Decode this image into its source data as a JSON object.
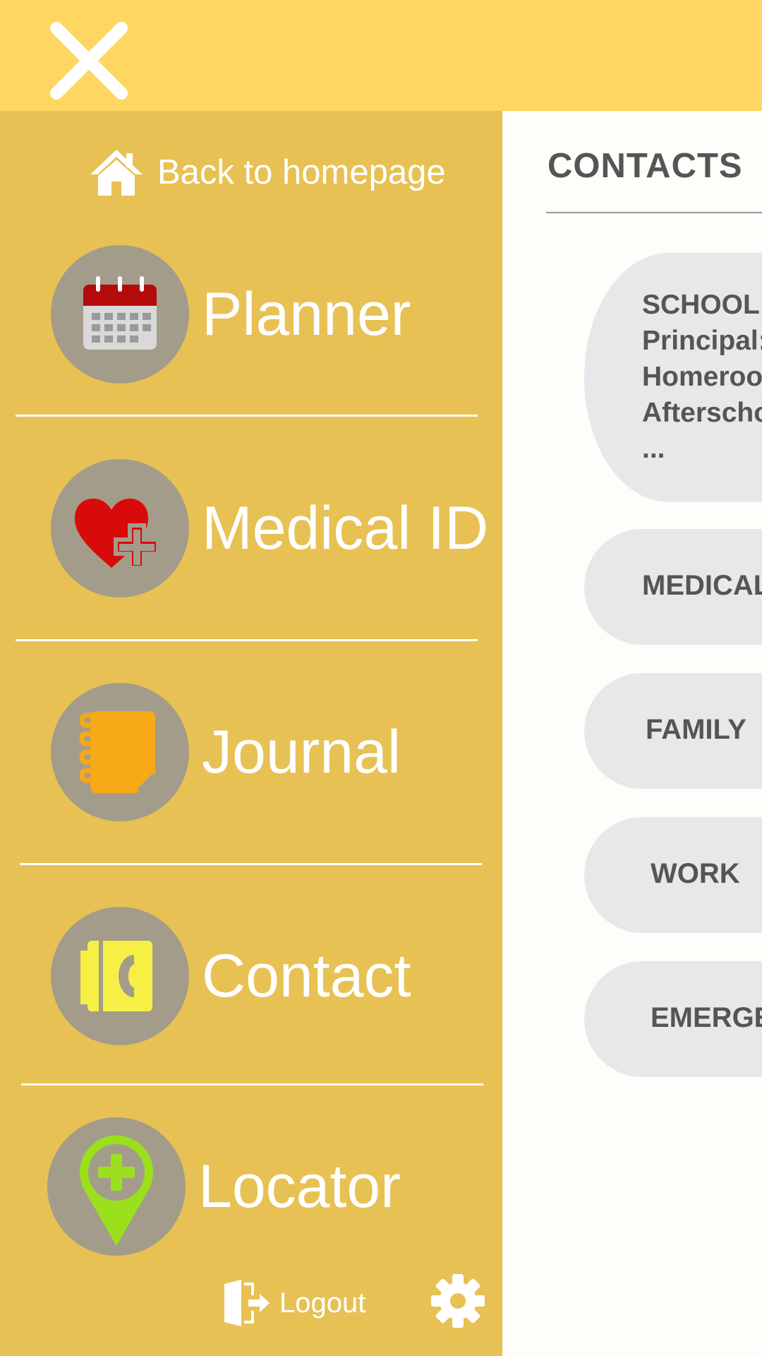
{
  "header": {
    "close_icon": "close-icon"
  },
  "sidebar": {
    "home_link": "Back to homepage",
    "items": [
      {
        "label": "Planner",
        "icon": "calendar-icon"
      },
      {
        "label": "Medical ID",
        "icon": "heart-plus-icon"
      },
      {
        "label": "Journal",
        "icon": "notebook-icon"
      },
      {
        "label": "Contact",
        "icon": "contact-book-icon"
      },
      {
        "label": "Locator",
        "icon": "map-pin-plus-icon"
      }
    ],
    "logout": "Logout",
    "settings_icon": "gear-icon"
  },
  "content": {
    "title": "CONTACTS",
    "school_card": {
      "lines": [
        "SCHOOL",
        "Principal:",
        "Homeroom",
        "Afterschool",
        "..."
      ]
    },
    "cards": [
      "MEDICAL",
      "FAMILY",
      "WORK",
      "EMERGENCY"
    ]
  },
  "colors": {
    "topbar": "#ffd661",
    "sidebar": "#e8c154",
    "nav_circle": "#a39c8b",
    "card": "#e8e8ea",
    "text_dark": "#555555"
  }
}
